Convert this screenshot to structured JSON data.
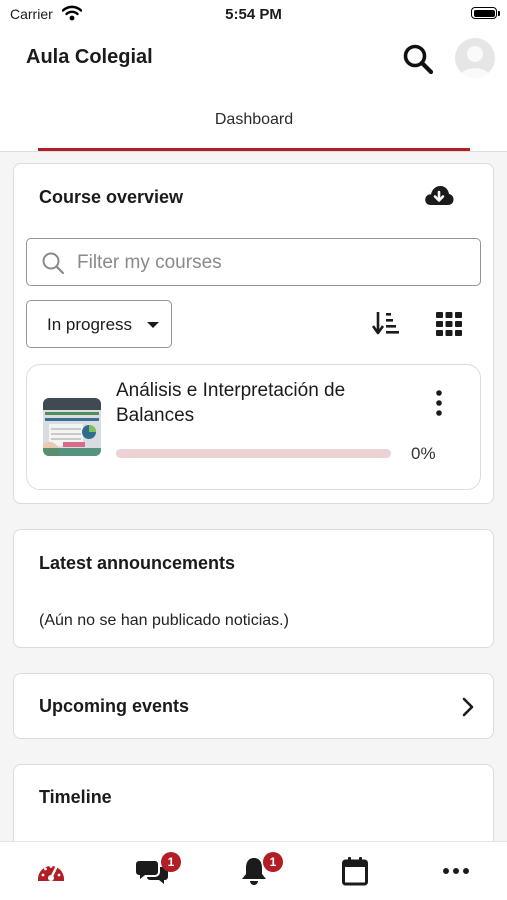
{
  "status_bar": {
    "carrier": "Carrier",
    "time": "5:54 PM"
  },
  "header": {
    "title": "Aula Colegial",
    "active_tab": "Dashboard"
  },
  "course_overview": {
    "title": "Course overview",
    "filter_placeholder": "Filter my courses",
    "status_filter": "In progress",
    "course": {
      "name": "Análisis e Interpretación de Balances",
      "progress_percent": 0,
      "progress_label": "0%"
    }
  },
  "latest_announcements": {
    "title": "Latest announcements",
    "empty_message": "(Aún no se han publicado noticias.)"
  },
  "upcoming_events": {
    "title": "Upcoming events"
  },
  "timeline": {
    "title": "Timeline"
  },
  "bottom_nav": {
    "items": [
      {
        "icon": "dashboard-gauge-icon",
        "active": true
      },
      {
        "icon": "messages-icon",
        "badge": "1"
      },
      {
        "icon": "notifications-bell-icon",
        "badge": "1"
      },
      {
        "icon": "calendar-icon"
      },
      {
        "icon": "more-icon"
      }
    ]
  },
  "colors": {
    "accent": "#b11e26",
    "progress_track": "#ecd2d2",
    "background": "#f5f5f5"
  }
}
